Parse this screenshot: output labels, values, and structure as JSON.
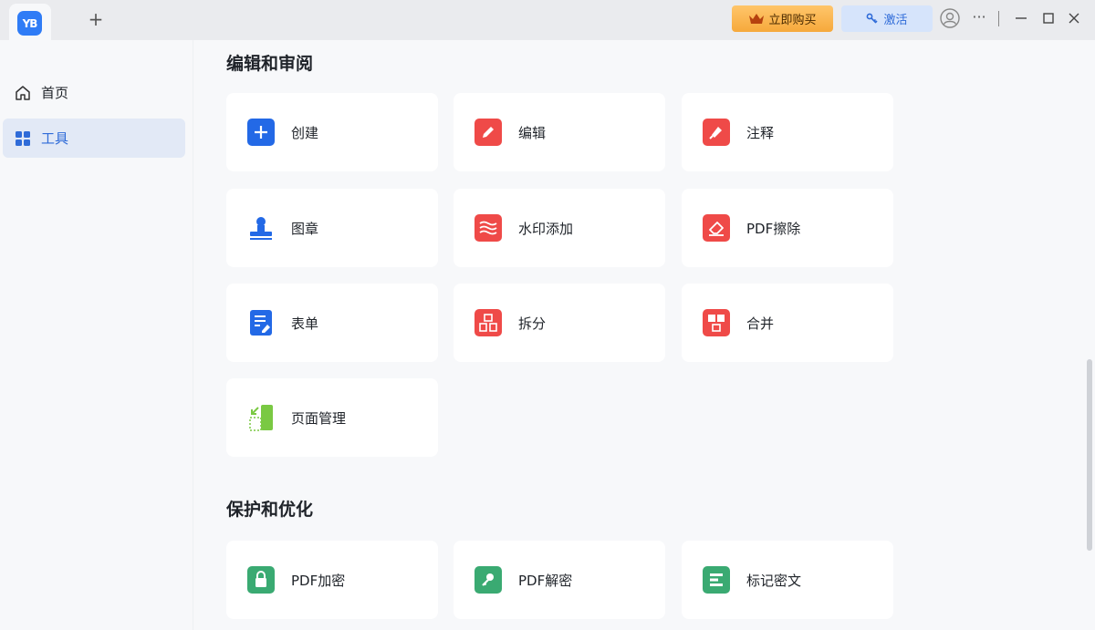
{
  "app": {
    "logo_text": "YB",
    "new_tab": "+"
  },
  "header": {
    "buy_label": "立即购买",
    "activate_label": "激活",
    "more": "···"
  },
  "sidebar": {
    "items": [
      {
        "label": "首页",
        "icon": "home-icon"
      },
      {
        "label": "工具",
        "icon": "grid-icon",
        "active": true
      }
    ]
  },
  "sections": [
    {
      "title": "编辑和审阅",
      "tools": [
        {
          "label": "创建",
          "icon": "plus-icon",
          "color": "#2369e6"
        },
        {
          "label": "编辑",
          "icon": "pencil-icon",
          "color": "#ef4a48"
        },
        {
          "label": "注释",
          "icon": "highlighter-icon",
          "color": "#ef4a48"
        },
        {
          "label": "图章",
          "icon": "stamp-icon",
          "color": "#2369e6"
        },
        {
          "label": "水印添加",
          "icon": "watermark-icon",
          "color": "#ef4a48"
        },
        {
          "label": "PDF擦除",
          "icon": "eraser-icon",
          "color": "#ef4a48"
        },
        {
          "label": "表单",
          "icon": "form-icon",
          "color": "#2369e6"
        },
        {
          "label": "拆分",
          "icon": "split-icon",
          "color": "#ef4a48"
        },
        {
          "label": "合并",
          "icon": "merge-icon",
          "color": "#ef4a48"
        },
        {
          "label": "页面管理",
          "icon": "page-manage-icon",
          "color": "#7ac943"
        }
      ]
    },
    {
      "title": "保护和优化",
      "tools": [
        {
          "label": "PDF加密",
          "icon": "lock-icon",
          "color": "#3aaa72"
        },
        {
          "label": "PDF解密",
          "icon": "key-icon",
          "color": "#3aaa72"
        },
        {
          "label": "标记密文",
          "icon": "redact-icon",
          "color": "#3aaa72"
        }
      ]
    }
  ],
  "colors": {
    "accent": "#2f6bd8",
    "buy": "#f6a93b",
    "activate_bg": "#d6e4fb"
  }
}
